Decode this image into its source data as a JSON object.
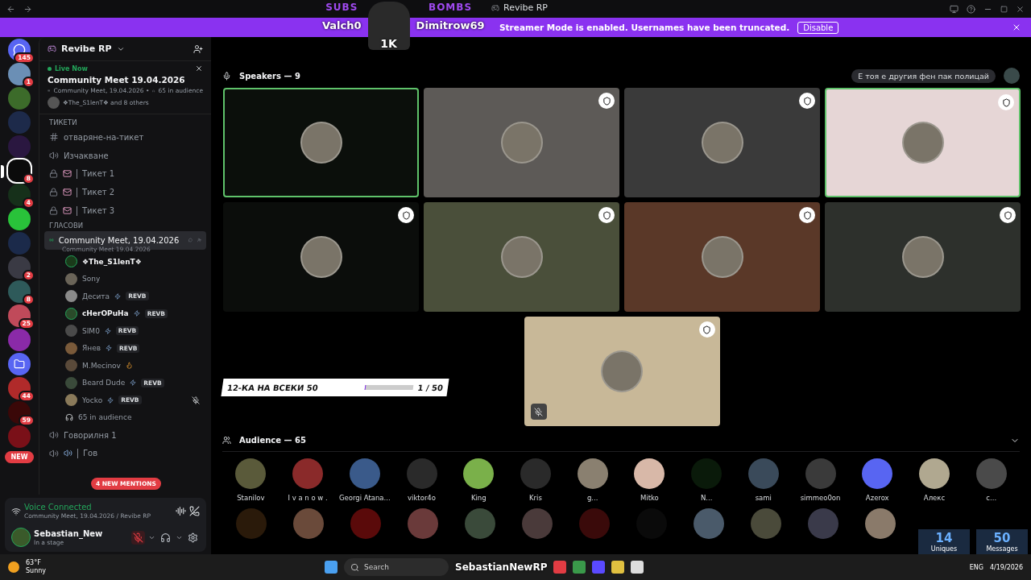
{
  "titlebar": {
    "title": "Revibe RP"
  },
  "banner": {
    "text": "Streamer Mode is enabled. Usernames have been truncated.",
    "button": "Disable"
  },
  "overlay_top": {
    "subs_label": "SUBS",
    "subs_name": "Valch0",
    "bombs_label": "BOMBS",
    "bombs_name": "Dimitrow69",
    "count": "1K"
  },
  "servers": [
    {
      "kind": "home",
      "badge": "145",
      "color": "#5865f2",
      "selected": false
    },
    {
      "kind": "server",
      "badge": "1",
      "color": "#6b8fb5",
      "selected": false
    },
    {
      "kind": "server",
      "color": "#3c6b2a",
      "selected": false
    },
    {
      "kind": "server",
      "color": "#1d2a4a",
      "selected": false
    },
    {
      "kind": "server",
      "color": "#2a1740",
      "selected": false
    },
    {
      "kind": "server",
      "badge": "8",
      "color": "#0b0b0b",
      "selected": true
    },
    {
      "kind": "server",
      "badge": "4",
      "color": "#16301a",
      "selected": false
    },
    {
      "kind": "server",
      "color": "#29c23a",
      "selected": false
    },
    {
      "kind": "server",
      "color": "#1b2a4a",
      "selected": false
    },
    {
      "kind": "server",
      "badge": "2",
      "color": "#3a3a44",
      "selected": false
    },
    {
      "kind": "server",
      "badge": "8",
      "color": "#2e5a5a",
      "selected": false
    },
    {
      "kind": "server",
      "badge": "25",
      "color": "#c04a5a",
      "selected": false
    },
    {
      "kind": "server",
      "color": "#8a2aa8",
      "selected": false
    },
    {
      "kind": "folder",
      "color": "#5865f2",
      "selected": false
    },
    {
      "kind": "server",
      "badge": "44",
      "color": "#b02a2a",
      "selected": false
    },
    {
      "kind": "server",
      "badge": "59",
      "color": "#3a0808",
      "selected": false
    },
    {
      "kind": "server",
      "color": "#7a1018",
      "selected": false
    }
  ],
  "new_badge": "NEW",
  "sidebar": {
    "server": "Revibe RP",
    "live": {
      "label": "Live Now",
      "title": "Community Meet 19.04.2026",
      "stage": "Community Meet, 19.04.2026 •",
      "audience": "65 in audience",
      "speakers": "❖The_S1lenT❖ and 8 others"
    },
    "channels": [
      {
        "kind": "category",
        "name": "ТИКЕТИ"
      },
      {
        "kind": "text",
        "name": "отваряне-на-тикет",
        "selected": false
      },
      {
        "kind": "voice",
        "name": "Изчакване",
        "selected": false
      },
      {
        "kind": "locked",
        "name": "Тикет 1",
        "selected": false
      },
      {
        "kind": "locked",
        "name": "Тикет 2",
        "selected": false
      },
      {
        "kind": "locked",
        "name": "Тикет 3",
        "selected": false
      },
      {
        "kind": "category",
        "name": "ГЛАСОВИ"
      },
      {
        "kind": "stage",
        "name": "Community Meet, 19.04.2026",
        "topic": "Community Meet 19.04.2026",
        "selected": true,
        "audience": "65 in audience",
        "members": [
          {
            "name": "❖The_S1lenT❖",
            "speaker": true,
            "muted": false,
            "color": "#1a3a1a"
          },
          {
            "name": "Sony",
            "speaker": false,
            "muted": false,
            "color": "#6a6458"
          },
          {
            "name": "Десита",
            "tag": "REVB",
            "speaker": false,
            "muted": false,
            "color": "#8a8a8a"
          },
          {
            "name": "cHerOPuHa",
            "tag": "REVB",
            "speaker": true,
            "muted": false,
            "color": "#2a4a2a"
          },
          {
            "name": "SIM0",
            "tag": "REVB",
            "speaker": false,
            "muted": false,
            "color": "#4a4a4a"
          },
          {
            "name": "Янев",
            "tag": "REVB",
            "speaker": false,
            "muted": false,
            "color": "#7a5a3a"
          },
          {
            "name": "M.Mecinov",
            "speaker": false,
            "muted": false,
            "color": "#5a4a3a"
          },
          {
            "name": "Beard Dude",
            "tag": "REVB",
            "speaker": false,
            "muted": false,
            "color": "#3a4a3a"
          },
          {
            "name": "Yocko",
            "tag": "REVB",
            "speaker": false,
            "muted": true,
            "color": "#8a7a5a"
          }
        ]
      },
      {
        "kind": "voice",
        "name": "Говорилня 1",
        "selected": false
      },
      {
        "kind": "voice",
        "name": "Гов",
        "selected": false
      }
    ],
    "mentions": "4 NEW MENTIONS"
  },
  "voice_panel": {
    "status": "Voice Connected",
    "location": "Community Meet, 19.04.2026 / Revibe RP"
  },
  "user": {
    "name": "Sebastian_New",
    "status": "In a stage",
    "mic_muted": true
  },
  "stage": {
    "speakers_title": "Speakers — 9",
    "chip": "Е тоя е другия фен пак полицай",
    "tiles": [
      {
        "color": "#0b0f0b",
        "speaking": true,
        "moderator": false,
        "muted": false
      },
      {
        "color": "#5d5a57",
        "speaking": false,
        "moderator": true,
        "muted": false
      },
      {
        "color": "#3a3a3a",
        "speaking": false,
        "moderator": true,
        "muted": false
      },
      {
        "color": "#e6d6d6",
        "speaking": true,
        "moderator": true,
        "muted": false
      },
      {
        "color": "#0b0d0b",
        "speaking": false,
        "moderator": true,
        "muted": false
      },
      {
        "color": "#4a4f3a",
        "speaking": false,
        "moderator": true,
        "muted": false
      },
      {
        "color": "#5a3828",
        "speaking": false,
        "moderator": true,
        "muted": false
      },
      {
        "color": "#2d302c",
        "speaking": false,
        "moderator": true,
        "muted": false
      },
      {
        "color": "#c8b898",
        "speaking": false,
        "moderator": true,
        "muted": true
      }
    ],
    "audience_title": "Audience — 65",
    "audience": [
      {
        "name": "Stanilov",
        "color": "#5a5a3a"
      },
      {
        "name": "I v a n o w .",
        "color": "#8a2a2a"
      },
      {
        "name": "Georgi Atana...",
        "color": "#3a5a8a"
      },
      {
        "name": "viktor4o",
        "color": "#2a2a2a"
      },
      {
        "name": "King",
        "color": "#7ab04a"
      },
      {
        "name": "Kris",
        "color": "#2a2a2a"
      },
      {
        "name": "g...",
        "color": "#8a8070"
      },
      {
        "name": "Mitko",
        "color": "#d8b8a8"
      },
      {
        "name": "N...",
        "color": "#0a1a0a"
      },
      {
        "name": "sami",
        "color": "#3a4a5a"
      },
      {
        "name": "simmeo0on",
        "color": "#3a3a3a"
      },
      {
        "name": "Azerox",
        "color": "#5865f2"
      },
      {
        "name": "Алекс",
        "color": "#b0a890"
      },
      {
        "name": "c...",
        "color": "#4a4a4a"
      }
    ],
    "audience_more": [
      {
        "color": "#2a1a0a"
      },
      {
        "color": "#6a4a3a"
      },
      {
        "color": "#5a0a0a"
      },
      {
        "color": "#6a3a3a"
      },
      {
        "color": "#3a4a3a"
      },
      {
        "color": "#4a3a3a"
      },
      {
        "color": "#3a0a0a"
      },
      {
        "color": "#0a0a0a"
      },
      {
        "color": "#4a5a6a"
      },
      {
        "color": "#4a4a3a"
      },
      {
        "color": "#3a3a4a"
      },
      {
        "color": "#8a7a6a"
      }
    ]
  },
  "ticker": {
    "title": "12-КА НА ВСЕКИ 50",
    "progress": "1 / 50",
    "level": 0.02
  },
  "stats": [
    {
      "value": "14",
      "label": "Uniques"
    },
    {
      "value": "50",
      "label": "Messages"
    }
  ],
  "taskbar": {
    "temp": "63°F",
    "weather": "Sunny",
    "search": "Search",
    "stream_name": "SebastianNewRP",
    "lang": "ENG",
    "date": "4/19/2026"
  }
}
